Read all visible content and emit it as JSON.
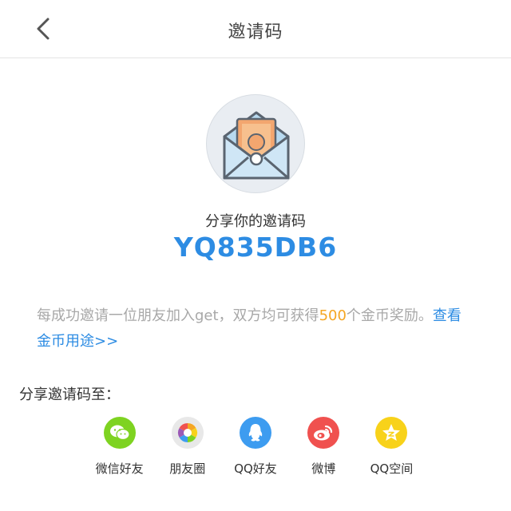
{
  "header": {
    "title": "邀请码"
  },
  "invite": {
    "label": "分享你的邀请码",
    "code": "YQ835DB6"
  },
  "description": {
    "prefix": "每成功邀请一位朋友加入get，双方均可获得",
    "amount": "500",
    "suffix": "个金币奖励。",
    "link": "查看金币用途>>"
  },
  "share": {
    "title": "分享邀请码至：",
    "items": [
      {
        "label": "微信好友",
        "icon": "wechat-icon",
        "color": "#7ed321"
      },
      {
        "label": "朋友圈",
        "icon": "moments-icon",
        "color": "#e8e8e8"
      },
      {
        "label": "QQ好友",
        "icon": "qq-icon",
        "color": "#3d9cf0"
      },
      {
        "label": "微博",
        "icon": "weibo-icon",
        "color": "#f0514f"
      },
      {
        "label": "QQ空间",
        "icon": "qzone-icon",
        "color": "#f8d21a"
      }
    ]
  },
  "colors": {
    "accent": "#2d8ce3",
    "highlight": "#f5a623",
    "muted_text": "#a8a8a8"
  }
}
